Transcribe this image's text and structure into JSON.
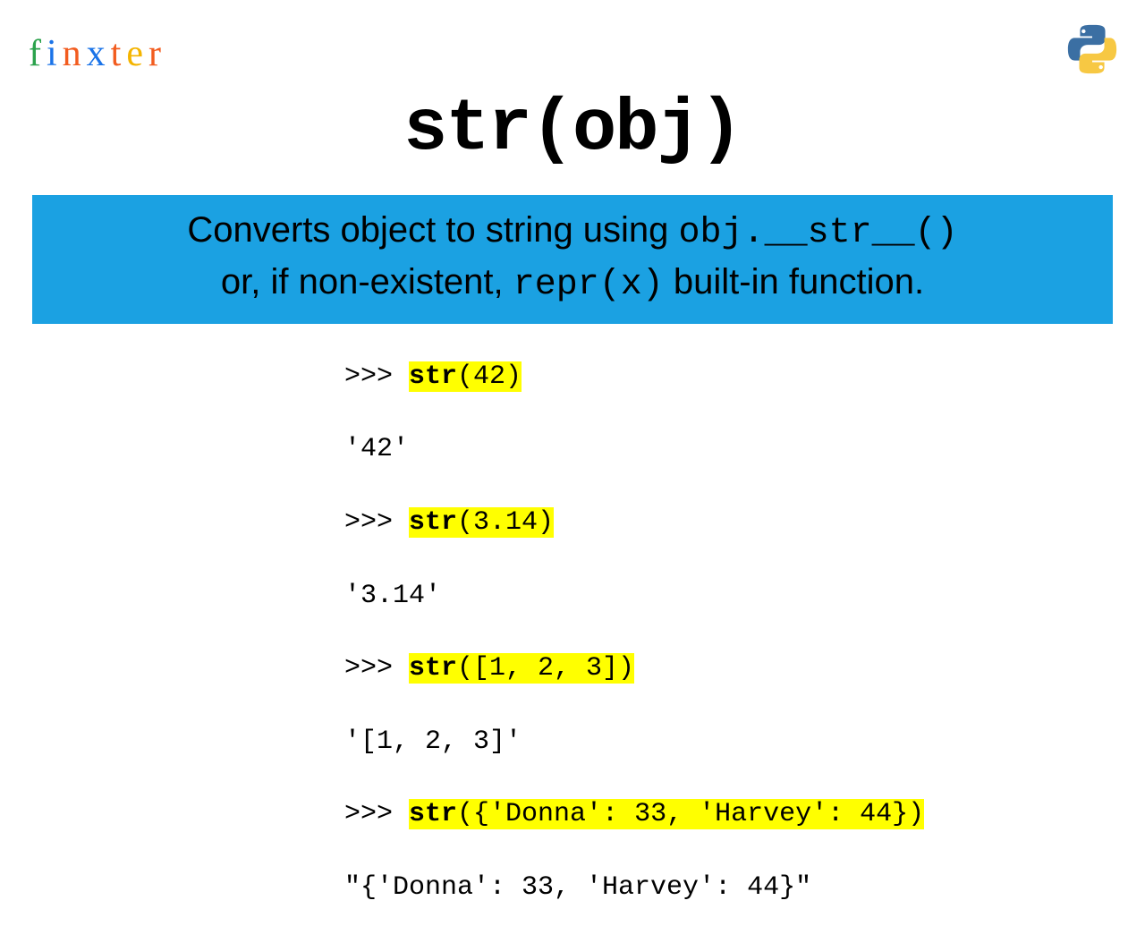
{
  "brand": {
    "letters": [
      "f",
      "i",
      "n",
      "x",
      "t",
      "e",
      "r"
    ],
    "colors": [
      "#2ba24c",
      "#1a73e8",
      "#f25c1f",
      "#1a73e8",
      "#f25c1f",
      "#f4b400",
      "#f25c1f"
    ]
  },
  "title": "str(obj)",
  "desc": {
    "line1_pre": "Converts object to string using ",
    "line1_code": "obj.__str__()",
    "line2_pre": "or, if non-existent, ",
    "line2_code": "repr(x)",
    "line2_post": " built-in function."
  },
  "code": {
    "prompts": [
      ">>> ",
      ">>> ",
      ">>> ",
      ">>> "
    ],
    "calls": [
      "str(42)",
      "str(3.14)",
      "str([1, 2, 3])",
      "str({'Donna': 33, 'Harvey': 44})"
    ],
    "outputs": [
      "'42'",
      "'3.14'",
      "'[1, 2, 3]'",
      "\"{'Donna': 33, 'Harvey': 44}\""
    ]
  },
  "python_logo": {
    "blue": "#3b6fa3",
    "yellow": "#f7c843"
  }
}
